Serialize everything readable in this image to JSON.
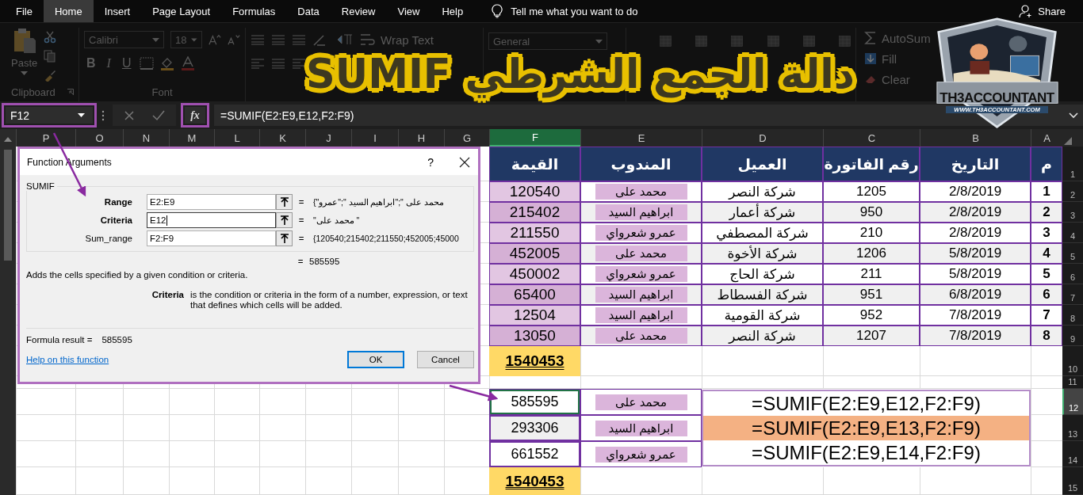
{
  "menu": {
    "tabs": [
      {
        "label": "File",
        "selected": false
      },
      {
        "label": "Home",
        "selected": true
      },
      {
        "label": "Insert",
        "selected": false
      },
      {
        "label": "Page Layout",
        "selected": false
      },
      {
        "label": "Formulas",
        "selected": false
      },
      {
        "label": "Data",
        "selected": false
      },
      {
        "label": "Review",
        "selected": false
      },
      {
        "label": "View",
        "selected": false
      },
      {
        "label": "Help",
        "selected": false
      }
    ],
    "tell_me": "Tell me what you want to do",
    "share": "Share"
  },
  "ribbon": {
    "paste": "Paste",
    "clipboard": "Clipboard",
    "font_name": "Calibri",
    "font_size": "18",
    "format_buttons": [
      "B",
      "I",
      "U"
    ],
    "font": "Font",
    "wrap_text": "Wrap Text",
    "number_format": "General",
    "autosum": "AutoSum",
    "fill": "Fill",
    "clear": "Clear"
  },
  "banner": {
    "title": "دالة الجمع الشرطي SUMIF",
    "logo_name": "TH3ACCOUNTANT",
    "logo_url": "WWW.TH3ACCOUNTANT.COM"
  },
  "formula_bar": {
    "name_box": "F12",
    "fx": "fx",
    "formula": "=SUMIF(E2:E9,E12,F2:F9)"
  },
  "sheet": {
    "columns": [
      {
        "letter": "P",
        "selected": false
      },
      {
        "letter": "O",
        "selected": false
      },
      {
        "letter": "N",
        "selected": false
      },
      {
        "letter": "M",
        "selected": false
      },
      {
        "letter": "L",
        "selected": false
      },
      {
        "letter": "K",
        "selected": false
      },
      {
        "letter": "J",
        "selected": false
      },
      {
        "letter": "I",
        "selected": false
      },
      {
        "letter": "H",
        "selected": false
      },
      {
        "letter": "G",
        "selected": false
      },
      {
        "letter": "F",
        "selected": true
      },
      {
        "letter": "E",
        "selected": false
      },
      {
        "letter": "D",
        "selected": false
      },
      {
        "letter": "C",
        "selected": false
      },
      {
        "letter": "B",
        "selected": false
      },
      {
        "letter": "A",
        "selected": false
      }
    ],
    "rows": [
      {
        "number": "1",
        "selected": false
      },
      {
        "number": "2",
        "selected": false
      },
      {
        "number": "3",
        "selected": false
      },
      {
        "number": "4",
        "selected": false
      },
      {
        "number": "5",
        "selected": false
      },
      {
        "number": "6",
        "selected": false
      },
      {
        "number": "7",
        "selected": false
      },
      {
        "number": "8",
        "selected": false
      },
      {
        "number": "9",
        "selected": false
      },
      {
        "number": "10",
        "selected": false
      },
      {
        "number": "11",
        "selected": false
      },
      {
        "number": "12",
        "selected": true
      },
      {
        "number": "13",
        "selected": false
      },
      {
        "number": "14",
        "selected": false
      },
      {
        "number": "15",
        "selected": false
      }
    ],
    "table": {
      "headers": [
        "م",
        "التاريخ",
        "رقم الفاتورة",
        "العميل",
        "المندوب",
        "القيمة"
      ],
      "rows": [
        {
          "no": "1",
          "date": "2/8/2019",
          "invoice": "1205",
          "client": "شركة النصر",
          "rep": "محمد على",
          "value": "120540"
        },
        {
          "no": "2",
          "date": "2/8/2019",
          "invoice": "950",
          "client": "شركة أعمار",
          "rep": "ابراهيم السيد",
          "value": "215402"
        },
        {
          "no": "3",
          "date": "2/8/2019",
          "invoice": "210",
          "client": "شركة المصطفي",
          "rep": "عمرو  شعرواي",
          "value": "211550"
        },
        {
          "no": "4",
          "date": "5/8/2019",
          "invoice": "1206",
          "client": "شركة  الأخوة",
          "rep": "محمد على",
          "value": "452005"
        },
        {
          "no": "5",
          "date": "5/8/2019",
          "invoice": "211",
          "client": "شركة الحاج",
          "rep": "عمرو  شعرواي",
          "value": "450002"
        },
        {
          "no": "6",
          "date": "6/8/2019",
          "invoice": "951",
          "client": "شركة الفسطاط",
          "rep": "ابراهيم السيد",
          "value": "65400"
        },
        {
          "no": "7",
          "date": "7/8/2019",
          "invoice": "952",
          "client": "شركة القومية",
          "rep": "ابراهيم السيد",
          "value": "12504"
        },
        {
          "no": "8",
          "date": "7/8/2019",
          "invoice": "1207",
          "client": "شركة النصر",
          "rep": "محمد على",
          "value": "13050"
        }
      ]
    },
    "total_1": "1540453",
    "summary": [
      {
        "value": "585595",
        "rep": "محمد على",
        "formula": "=SUMIF(E2:E9,E12,F2:F9)",
        "selected": true,
        "highlighted": false
      },
      {
        "value": "293306",
        "rep": "ابراهيم السيد",
        "formula": "=SUMIF(E2:E9,E13,F2:F9)",
        "selected": false,
        "highlighted": true
      },
      {
        "value": "661552",
        "rep": "عمرو  شعرواي",
        "formula": "=SUMIF(E2:E9,E14,F2:F9)",
        "selected": false,
        "highlighted": false
      }
    ],
    "total_2": "1540453"
  },
  "dialog": {
    "title": "Function Arguments",
    "help": "?",
    "function": "SUMIF",
    "args": [
      {
        "name": "Range",
        "value": "E2:E9",
        "required": true,
        "focused": false,
        "equals": "=",
        "preview": "{\"محمد على \";\"ابراهيم السيد \";\"عمرو"
      },
      {
        "name": "Criteria",
        "value": "E12",
        "required": true,
        "focused": true,
        "equals": "=",
        "preview": "\"محمد على \""
      },
      {
        "name": "Sum_range",
        "value": "F2:F9",
        "required": false,
        "focused": false,
        "equals": "=",
        "preview": "{120540;215402;211550;452005;45000"
      }
    ],
    "result_equals": "=",
    "result": "585595",
    "description": "Adds the cells specified by a given condition or criteria.",
    "arg_help_name": "Criteria",
    "arg_help_text": "is the condition or criteria in the form of a number, expression, or text that defines which cells will be added.",
    "formula_result_label": "Formula result =",
    "formula_result": "585595",
    "help_link": "Help on this function",
    "buttons": [
      {
        "label": "OK",
        "default": true
      },
      {
        "label": "Cancel",
        "default": false
      }
    ]
  }
}
